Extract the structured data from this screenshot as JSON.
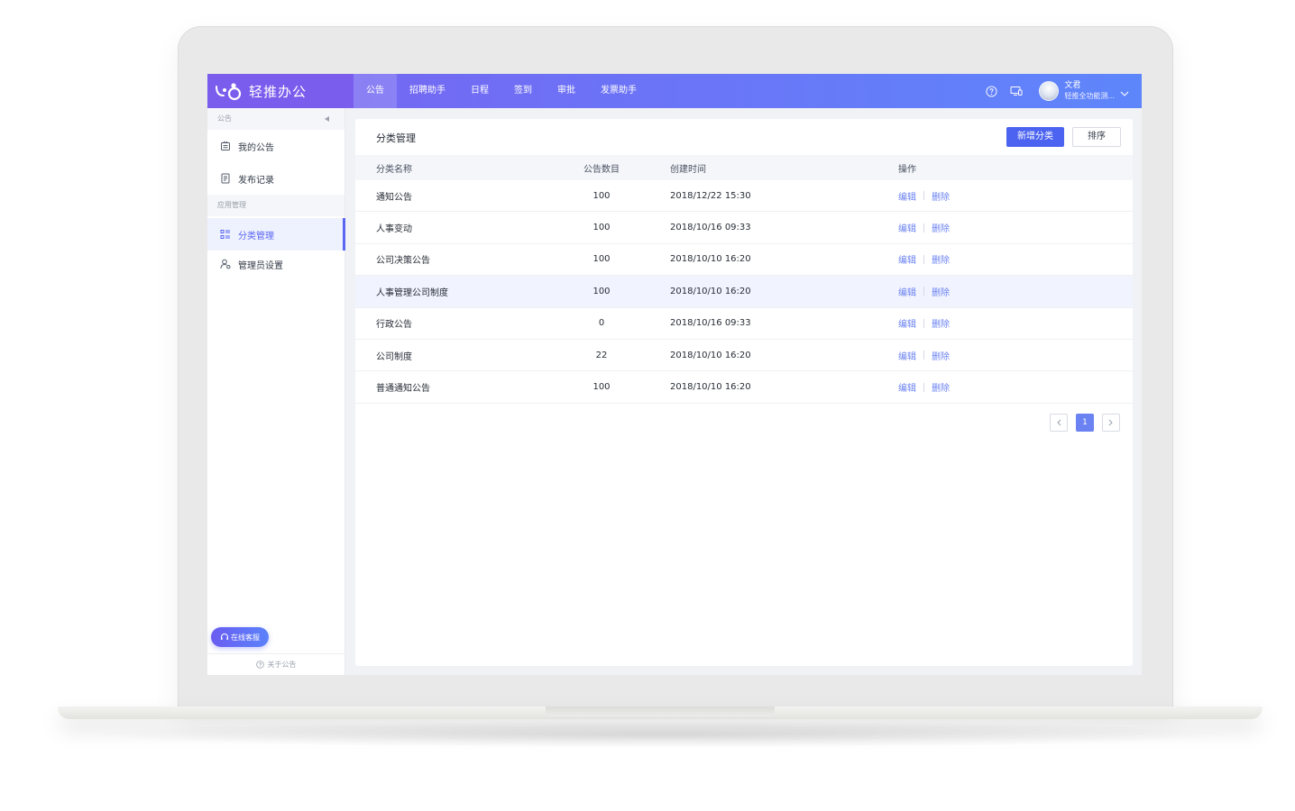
{
  "app": {
    "brand_name": "轻推办公",
    "accent_color": "#5a67f2"
  },
  "nav": {
    "items": [
      {
        "label": "公告"
      },
      {
        "label": "招聘助手"
      },
      {
        "label": "日程"
      },
      {
        "label": "签到"
      },
      {
        "label": "审批"
      },
      {
        "label": "发票助手"
      }
    ],
    "active_index": 0
  },
  "header": {
    "help_icon": "question-circle-icon",
    "device_icon": "devices-icon",
    "user_name": "文君",
    "user_org": "轻推全功能测..."
  },
  "sidebar": {
    "section1": "公告",
    "section2": "应用管理",
    "items": [
      {
        "label": "我的公告",
        "icon": "announcement-icon"
      },
      {
        "label": "发布记录",
        "icon": "document-list-icon"
      },
      {
        "label": "分类管理",
        "icon": "category-list-icon"
      },
      {
        "label": "管理员设置",
        "icon": "user-settings-icon"
      }
    ],
    "service_label": "在线客服",
    "about_label": "关于公告"
  },
  "main": {
    "title": "分类管理",
    "add_button": "新增分类",
    "sort_button": "排序",
    "columns": [
      "分类名称",
      "公告数目",
      "创建时间",
      "操作"
    ],
    "edit_label": "编辑",
    "delete_label": "删除",
    "rows": [
      {
        "name": "通知公告",
        "count": "100",
        "time": "2018/12/22 15:30"
      },
      {
        "name": "人事变动",
        "count": "100",
        "time": "2018/10/16 09:33"
      },
      {
        "name": "公司决策公告",
        "count": "100",
        "time": "2018/10/10 16:20"
      },
      {
        "name": "人事管理公司制度",
        "count": "100",
        "time": "2018/10/10 16:20"
      },
      {
        "name": "行政公告",
        "count": "0",
        "time": "2018/10/16 09:33"
      },
      {
        "name": "公司制度",
        "count": "22",
        "time": "2018/10/10 16:20"
      },
      {
        "name": "普通通知公告",
        "count": "100",
        "time": "2018/10/10 16:20"
      }
    ],
    "highlighted_row": 3,
    "pagination": {
      "current": "1"
    }
  }
}
